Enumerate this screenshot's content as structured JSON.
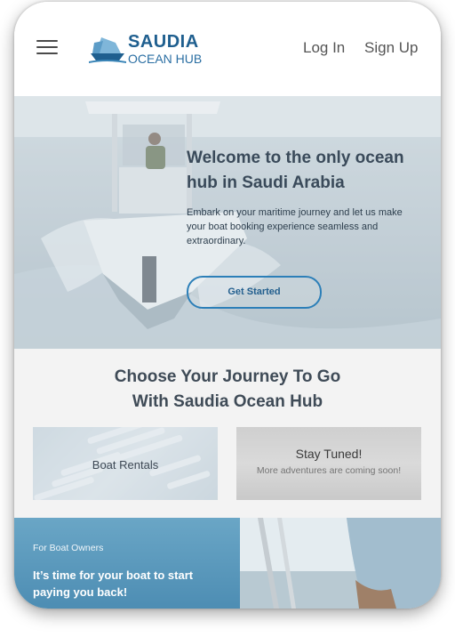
{
  "header": {
    "brand_top": "SAUDIA",
    "brand_bottom": "OCEAN HUB",
    "login": "Log In",
    "signup": "Sign Up"
  },
  "hero": {
    "title": "Welcome to the only ocean hub in Saudi Arabia",
    "subtitle": "Embark on your maritime journey and let us make your boat booking experience seamless and extraordinary.",
    "cta": "Get Started"
  },
  "choose": {
    "title_line1": "Choose Your Journey To Go",
    "title_line2": "With Saudia Ocean Hub",
    "rentals_label": "Boat Rentals",
    "tuned_title": "Stay Tuned!",
    "tuned_sub": "More adventures are coming soon!"
  },
  "owners": {
    "kicker": "For Boat Owners",
    "title": "It’s time for your boat to start paying you back!"
  },
  "colors": {
    "brand": "#1f5f8f",
    "cta_border": "#2c7fb8",
    "owners_bg": "#5b9bbf"
  },
  "icons": [
    "hamburger-menu-icon",
    "saudia-boat-logo"
  ]
}
